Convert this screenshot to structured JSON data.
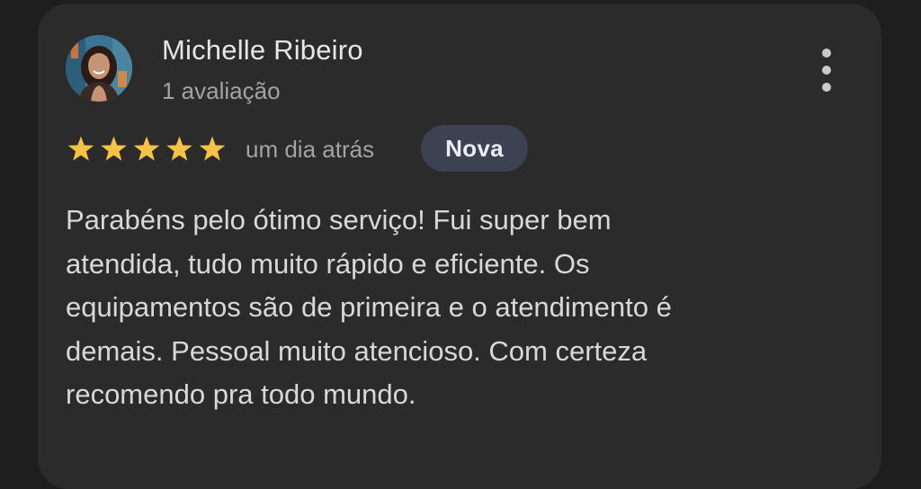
{
  "review": {
    "author": "Michelle Ribeiro",
    "author_meta": "1 avaliação",
    "rating": 5,
    "rating_max": 5,
    "date": "um dia atrás",
    "badge": "Nova",
    "text_lines": [
      "Parabéns pelo ótimo serviço! Fui super bem",
      "atendida, tudo muito rápido e eficiente. Os",
      "equipamentos são de primeira e o atendimento é",
      "demais. Pessoal muito atencioso. Com certeza",
      "recomendo pra todo mundo."
    ]
  },
  "icons": {
    "menu": "more-vert-icon",
    "star": "star-icon"
  },
  "colors": {
    "background": "#1e1e1e",
    "card": "#2b2b2b",
    "star": "#f6c244",
    "badge_bg": "#3d4252",
    "text_primary": "#e6e6e6",
    "text_secondary": "#a3a3a3"
  }
}
